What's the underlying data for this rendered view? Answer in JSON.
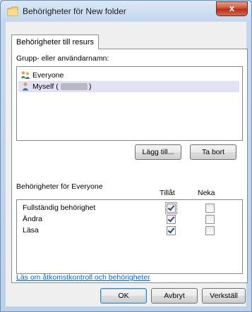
{
  "window": {
    "title": "Behörigheter för New folder",
    "close_label": "x"
  },
  "tab": {
    "label": "Behörigheter till resurs"
  },
  "groups": {
    "label": "Grupp- eller användarnamn:",
    "items": [
      {
        "label": "Everyone",
        "icon": "group-users-icon"
      },
      {
        "label": "Myself (",
        "suffix": ")",
        "icon": "user-icon",
        "selected": true
      }
    ]
  },
  "buttons": {
    "add": "Lägg till...",
    "remove": "Ta bort",
    "ok": "OK",
    "cancel": "Avbryt",
    "apply": "Verkställ"
  },
  "permissions": {
    "label": "Behörigheter för Everyone",
    "allow_header": "Tillåt",
    "deny_header": "Neka",
    "rows": [
      {
        "name": "Fullständig behörighet",
        "allow": true,
        "deny": false
      },
      {
        "name": "Ändra",
        "allow": true,
        "deny": false
      },
      {
        "name": "Läsa",
        "allow": true,
        "deny": false
      }
    ]
  },
  "help_link": "Läs om åtkomstkontroll och behörigheter"
}
